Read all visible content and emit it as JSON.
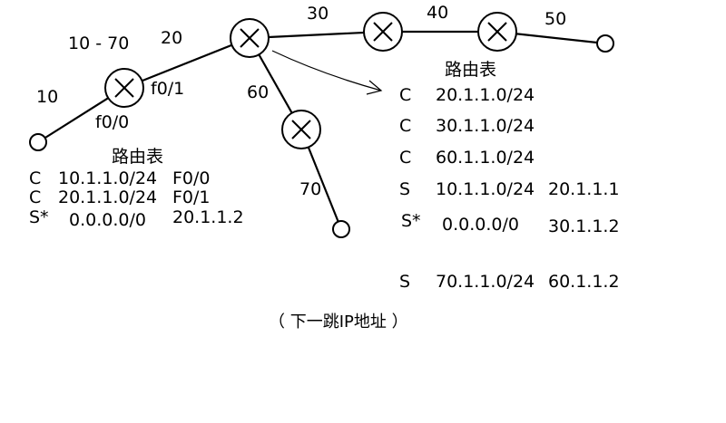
{
  "diagram": {
    "link_labels": {
      "range": "10 - 70",
      "net20": "20",
      "net10": "10",
      "net30": "30",
      "net40": "40",
      "net50": "50",
      "net60": "60",
      "net70": "70"
    },
    "interfaces": {
      "f0_1": "f0/1",
      "f0_0": "f0/0"
    },
    "left_table": {
      "title": "路由表",
      "rows": [
        {
          "type": "C",
          "network": "10.1.1.0/24",
          "via": "F0/0"
        },
        {
          "type": "C",
          "network": "20.1.1.0/24",
          "via": "F0/1"
        },
        {
          "type": "S*",
          "network": "0.0.0.0/0",
          "via": "20.1.1.2"
        }
      ]
    },
    "right_table": {
      "title": "路由表",
      "rows": [
        {
          "type": "C",
          "network": "20.1.1.0/24",
          "via": ""
        },
        {
          "type": "C",
          "network": "30.1.1.0/24",
          "via": ""
        },
        {
          "type": "C",
          "network": "60.1.1.0/24",
          "via": ""
        },
        {
          "type": "S",
          "network": "10.1.1.0/24",
          "via": "20.1.1.1"
        },
        {
          "type": "S*",
          "network": "0.0.0.0/0",
          "via": "30.1.1.2"
        },
        {
          "type": "S",
          "network": "70.1.1.0/24",
          "via": "60.1.1.2"
        }
      ]
    },
    "caption": "（ 下一跳IP地址 ）"
  }
}
